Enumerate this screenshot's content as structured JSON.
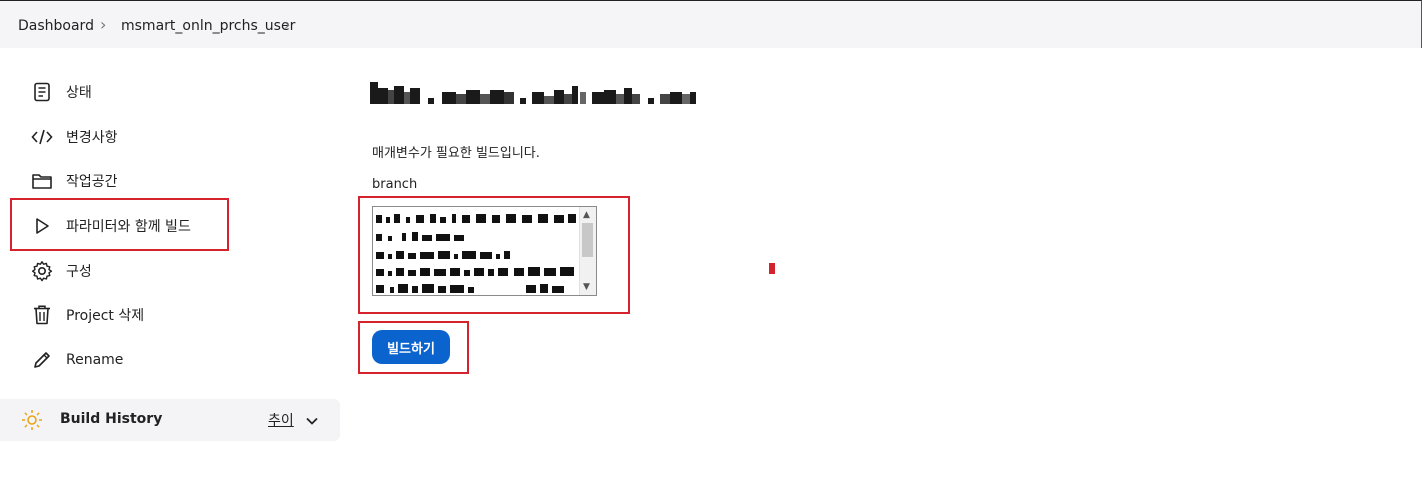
{
  "breadcrumb": {
    "items": [
      "Dashboard",
      "msmart_onln_prchs_user"
    ]
  },
  "sidebar": {
    "items": [
      {
        "label": "상태",
        "icon": "document-icon"
      },
      {
        "label": "변경사항",
        "icon": "code-icon"
      },
      {
        "label": "작업공간",
        "icon": "folder-icon"
      },
      {
        "label": "파라미터와 함께 빌드",
        "icon": "play-icon"
      },
      {
        "label": "구성",
        "icon": "gear-icon"
      },
      {
        "label": "Project 삭제",
        "icon": "trash-icon"
      },
      {
        "label": "Rename",
        "icon": "pencil-icon"
      }
    ]
  },
  "build_history": {
    "title": "Build History",
    "trend_label": "추이",
    "icon": "sun-icon"
  },
  "main": {
    "description": "매개변수가 필요한 빌드입니다.",
    "parameter": {
      "label": "branch"
    },
    "build_button_label": "빌드하기"
  },
  "colors": {
    "accent": "#0b63ce",
    "highlight": "#d4232c"
  }
}
